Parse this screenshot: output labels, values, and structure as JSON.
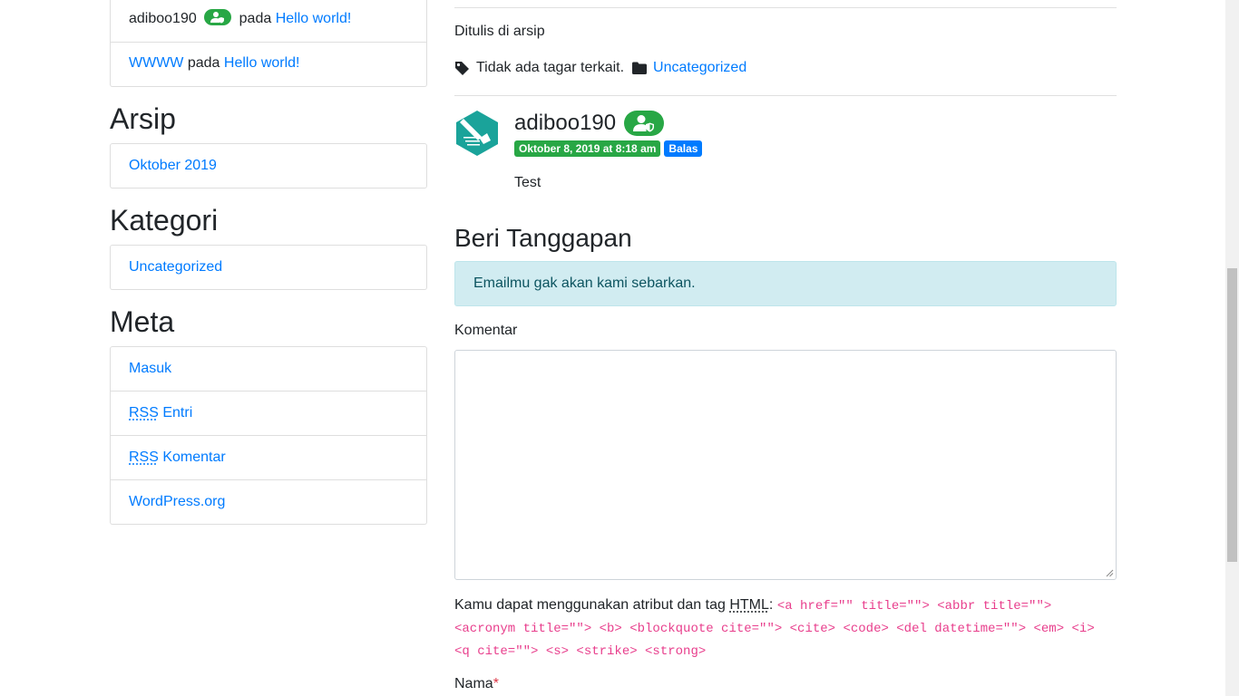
{
  "sidebar": {
    "recent_comments": [
      {
        "author": "adiboo190",
        "joiner": "pada",
        "post": "Hello world!"
      },
      {
        "author": "WWWW",
        "joiner": "pada",
        "post": "Hello world!"
      }
    ],
    "archive": {
      "title": "Arsip",
      "items": [
        "Oktober 2019"
      ]
    },
    "categories": {
      "title": "Kategori",
      "items": [
        "Uncategorized"
      ]
    },
    "meta": {
      "title": "Meta",
      "items": {
        "login": "Masuk",
        "rss_abbr": "RSS",
        "entries": "Entri",
        "comments": "Komentar",
        "wordpress": "WordPress.org"
      }
    }
  },
  "post_footer": {
    "posted_in": "Ditulis di arsip",
    "no_tags": "Tidak ada tagar terkait.",
    "category": "Uncategorized"
  },
  "comment": {
    "author": "adiboo190",
    "date": "Oktober 8, 2019 at 8:18 am",
    "reply": "Balas",
    "text": "Test"
  },
  "reply_form": {
    "title": "Beri Tanggapan",
    "notice": "Emailmu gak akan kami sebarkan.",
    "comment_label": "Komentar",
    "allowed_intro": "Kamu dapat menggunakan atribut dan tag",
    "allowed_abbr": "HTML",
    "allowed_colon": ":",
    "allowed_tags": "<a href=\"\" title=\"\"> <abbr title=\"\"> <acronym title=\"\"> <b> <blockquote cite=\"\"> <cite> <code> <del datetime=\"\"> <em> <i> <q cite=\"\"> <s> <strike> <strong>",
    "name_label": "Nama",
    "required_mark": "*"
  },
  "colors": {
    "link": "#007bff",
    "success": "#28a745",
    "info_bg": "#d1ecf1",
    "code": "#e83e8c",
    "avatar": "#1aa39a"
  },
  "icons": {
    "user_badge": "user-shield-icon",
    "tag": "tag-icon",
    "folder": "folder-icon"
  }
}
